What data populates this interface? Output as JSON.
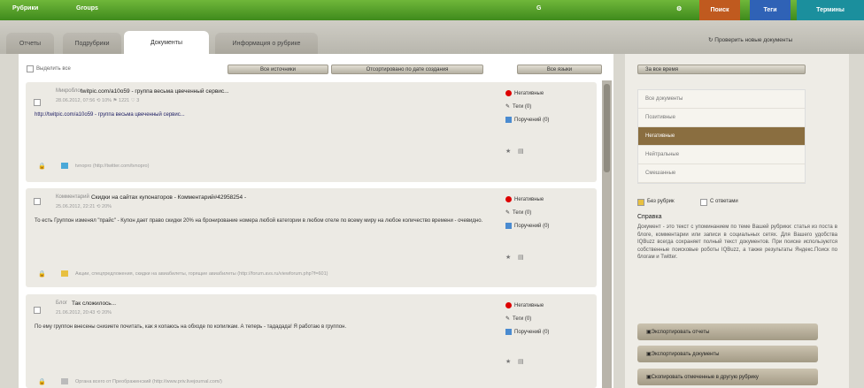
{
  "topbar": {
    "rubrics": "Рубрики",
    "groups": "Groups",
    "search": "Поиск",
    "tags": "Теги",
    "terms": "Термины",
    "g_icon": "G"
  },
  "tabs": [
    "Отчеты",
    "Подрубрики",
    "Документы",
    "Информация о рубрике"
  ],
  "check_new": "Проверить новые документы",
  "select_all": "Выделить все",
  "filters": {
    "all_sources": "Все источники",
    "sort": "Отсортировано по дате создания",
    "all_langs": "Все языки"
  },
  "period": "За все время",
  "docs": [
    {
      "source": "Микроблог",
      "title": "twitpic.com/a10o59 - группа весьма цвеченный сервис...",
      "meta": "28.06.2012, 07:56   ⟲ 10%   ⚑ 1221   ♡ 3",
      "body": "http://twitpic.com/a10o59 - группа весьма цвеченный сервис...",
      "foot": "tvnopro (http://twitter.com/tvnopro)",
      "status": "Негативные",
      "tags": "Теги (0)",
      "assign": "Поручений (0)"
    },
    {
      "source": "Комментарий",
      "title": "Скидки на сайтах купонаторов - Комментарий#42958254 -",
      "meta": "25.06.2012, 22:21   ⟲ 20%",
      "body": "То есть Группон изменял \"прайс\" - Купон дает право скидки 20% на бронирование номера любой категории в любом отеле по всему миру на любое количество времени - очевидно.",
      "foot": "Акции, спецпредложения, скидки на авиабилеты, горящие авиабилеты (http://forum.avs.ru/viewforum.php?f=601)",
      "status": "Негативные",
      "tags": "Теги (0)",
      "assign": "Поручений (0)"
    },
    {
      "source": "Блог",
      "title": "Так сложилось...",
      "meta": "21.06.2012, 20:43   ⟲ 20%",
      "body": "По ему группон внесены снизиете почитать, как я копаюсь на обходе по копилкам. А теперь - тададада! Я работаю в группон.",
      "foot": "Органа всего от Преображенский (http://www.priv.livejournal.com/)",
      "status": "Негативные",
      "tags": "Теги (0)",
      "assign": "Поручений (0)"
    }
  ],
  "side": {
    "items": [
      "Все документы",
      "Позитивные",
      "Негативные",
      "Нейтральные",
      "Смешанные"
    ],
    "no_rubric": "Без рубрик",
    "with_answers": "С ответами",
    "help_title": "Справка",
    "help_text": "Документ - это текст с упоминанием по теме Вашей рубрики: статья из поста в блоге, комментарии или записи в социальных сетях. Для Вашего удобства IQBuzz всегда сохраняет полный текст документов. При поиске используются собственные поисковые роботы IQBuzz, а также результаты Яндекс.Поиск по блогам и Twitter.",
    "btn1": "Экспортировать отчеты",
    "btn2": "Экспортировать документы",
    "btn3": "Скопировать отмеченные в другую рубрику"
  }
}
